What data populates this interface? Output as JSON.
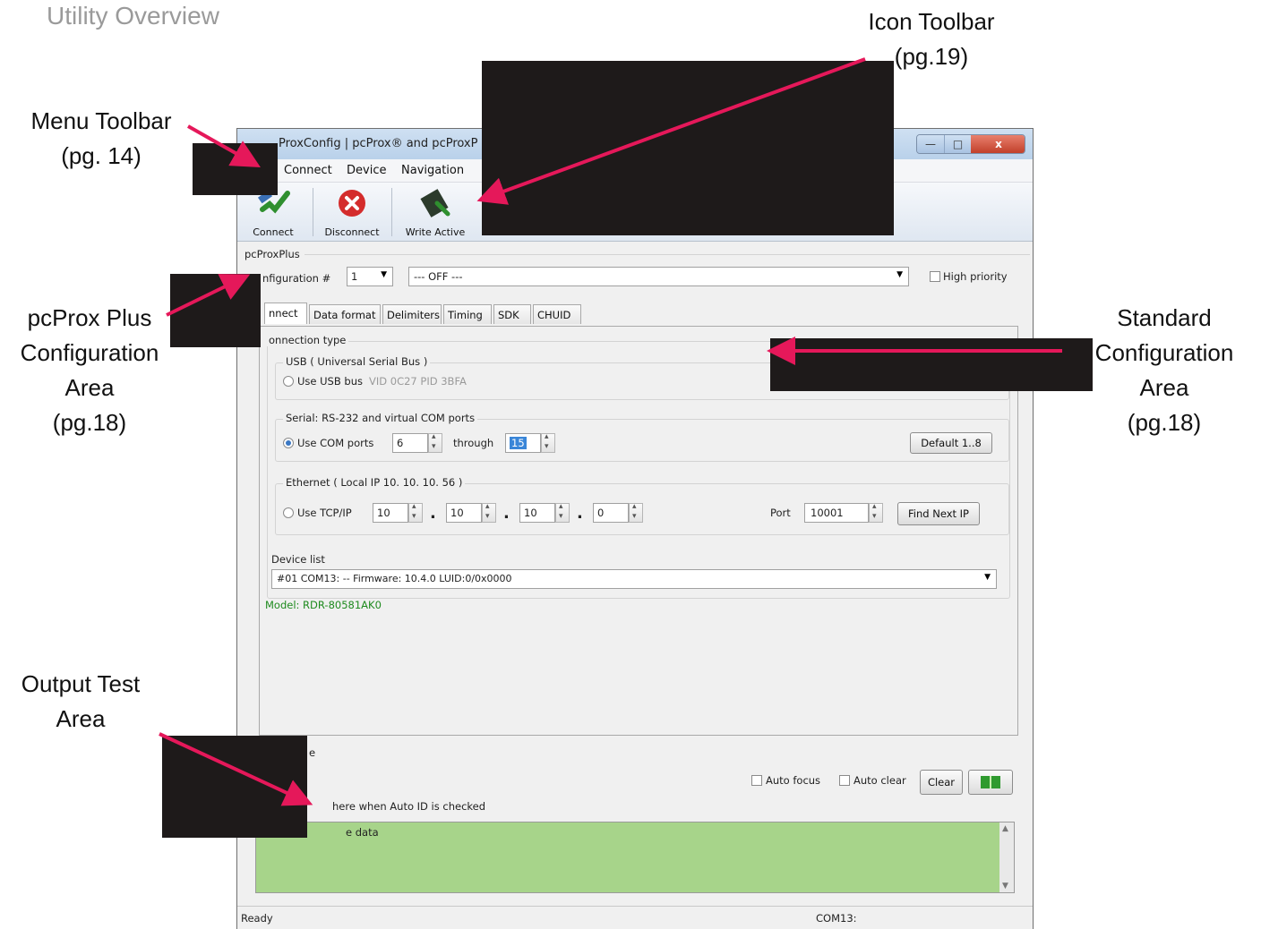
{
  "page": {
    "title": "Utility Overview"
  },
  "callouts": {
    "menu_toolbar": [
      "Menu Toolbar",
      "(pg. 14)"
    ],
    "icon_toolbar": [
      "Icon Toolbar",
      "(pg.19)"
    ],
    "pcprox_config": [
      "pcProx Plus",
      "Configuration",
      "Area",
      "(pg.18)"
    ],
    "standard_config": [
      "Standard",
      "Configuration",
      "Area",
      "(pg.18)"
    ],
    "output_test": [
      "Output Test",
      "Area"
    ]
  },
  "window": {
    "title": "ProxConfig | pcProx® and pcProxP",
    "controls": {
      "minimize": "—",
      "maximize": "□",
      "close": "x"
    },
    "menu": [
      "Connect",
      "Device",
      "Navigation"
    ],
    "toolbar": {
      "connect": "Connect",
      "disconnect": "Disconnect",
      "write_active": "Write Active"
    },
    "section_label": "pcProxPlus",
    "configuration": {
      "label": "nfiguration #",
      "number": "1",
      "mode": "--- OFF ---",
      "high_priority": "High priority"
    },
    "tabs": [
      "nnect",
      "Data format",
      "Delimiters",
      "Timing",
      "SDK",
      "CHUID"
    ],
    "connection": {
      "group_label": "onnection type",
      "usb": {
        "group_label": "USB ( Universal Serial Bus )",
        "option": "Use USB bus",
        "ids": "VID 0C27  PID 3BFA"
      },
      "serial": {
        "group_label": "Serial: RS-232 and virtual COM ports",
        "option": "Use COM ports",
        "from": "6",
        "through_label": "through",
        "to": "15",
        "default_button": "Default 1..8"
      },
      "ethernet": {
        "group_label": "Ethernet ( Local IP 10. 10. 10. 56 )",
        "option": "Use TCP/IP",
        "ip": [
          "10",
          "10",
          "10",
          "0"
        ],
        "port_label": "Port",
        "port": "10001",
        "find_button": "Find Next IP"
      },
      "device_list_label": "Device list",
      "device_selected": "#01 COM13: -- Firmware: 10.4.0 LUID:0/0x0000",
      "model": "Model: RDR-80581AK0"
    },
    "output": {
      "header_fragment": "e",
      "auto_focus": "Auto focus",
      "auto_clear": "Auto clear",
      "clear_button": "Clear",
      "hint": "here when Auto ID is checked",
      "text": "e data",
      "area_color": "#a7d48a"
    },
    "status": {
      "left": "Ready",
      "right": "COM13:"
    }
  },
  "colors": {
    "arrow": "#e5185a",
    "redaction": "#1e1a1a"
  }
}
